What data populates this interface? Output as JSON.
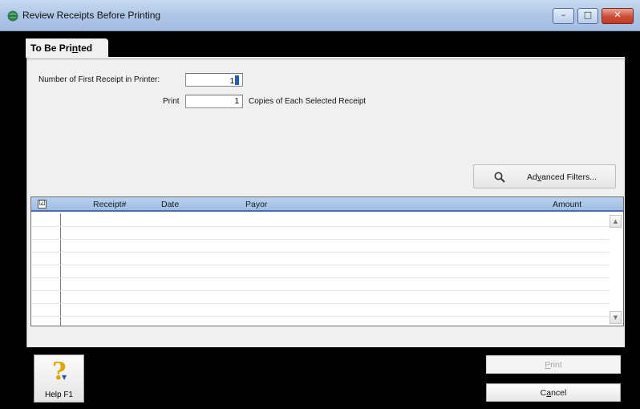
{
  "window": {
    "title": "Review Receipts Before Printing",
    "icon": "app-globe-icon",
    "controls": {
      "minimize": "–",
      "maximize": "□",
      "close": "✕"
    }
  },
  "tab": {
    "label_pre": "To Be Pri",
    "label_mnemonic": "n",
    "label_post": "ted"
  },
  "form": {
    "first_receipt_label": "Number of First Receipt in Printer:",
    "first_receipt_value": "1",
    "print_label": "Print",
    "print_copies_value": "1",
    "copies_suffix": "Copies of Each Selected Receipt"
  },
  "advanced_filters": {
    "icon": "magnifier-icon",
    "label_pre": "Ad",
    "label_mnemonic": "v",
    "label_post": "anced Filters..."
  },
  "grid": {
    "select_all_checked": true,
    "select_all_mark": "☑",
    "columns": [
      "Receipt#",
      "Date",
      "Payor",
      "Amount"
    ],
    "rows": []
  },
  "scroll": {
    "up": "▲",
    "down": "▼"
  },
  "help": {
    "symbol": "?",
    "label": "Help F1"
  },
  "buttons": {
    "print_mnemonic": "P",
    "print_rest": "rint",
    "cancel_pre": "C",
    "cancel_mnemonic": "a",
    "cancel_post": "ncel"
  }
}
